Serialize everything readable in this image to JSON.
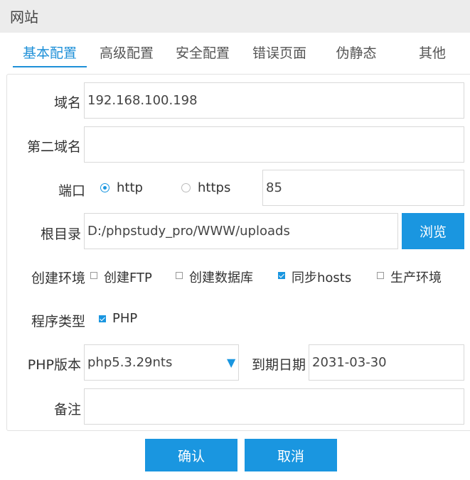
{
  "window": {
    "title": "网站"
  },
  "tabs": [
    "基本配置",
    "高级配置",
    "安全配置",
    "错误页面",
    "伪静态",
    "其他"
  ],
  "form": {
    "domain": {
      "label": "域名",
      "value": "192.168.100.198"
    },
    "second_domain": {
      "label": "第二域名",
      "value": ""
    },
    "port": {
      "label": "端口",
      "http": "http",
      "https": "https",
      "value": "85",
      "selected": "http"
    },
    "root": {
      "label": "根目录",
      "value": "D:/phpstudy_pro/WWW/uploads",
      "browse": "浏览"
    },
    "env": {
      "label": "创建环境",
      "options": [
        "创建FTP",
        "创建数据库",
        "同步hosts",
        "生产环境"
      ],
      "checked": [
        false,
        false,
        true,
        false
      ]
    },
    "program": {
      "label": "程序类型",
      "option": "PHP",
      "checked": true
    },
    "php_version": {
      "label": "PHP版本",
      "value": "php5.3.29nts"
    },
    "expire": {
      "label": "到期日期",
      "value": "2031-03-30"
    },
    "note": {
      "label": "备注",
      "value": ""
    }
  },
  "actions": {
    "confirm": "确认",
    "cancel": "取消"
  },
  "colors": {
    "accent": "#1a96e0",
    "titlebar": "#ececec",
    "border": "#d9d9d9"
  }
}
